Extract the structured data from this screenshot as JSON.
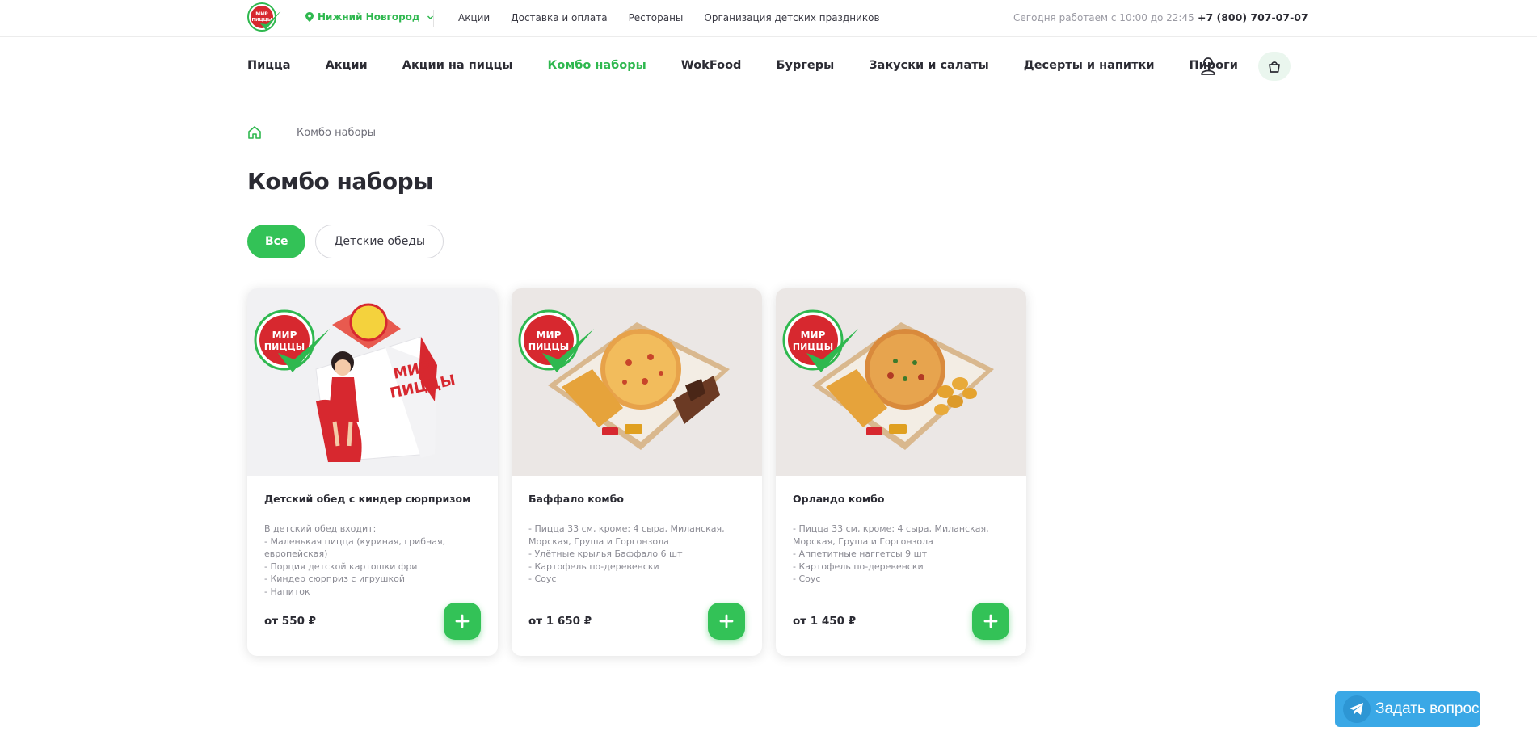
{
  "brand": {
    "logo_text": "МИР ПИЦЦЫ",
    "accent_color": "#33c257",
    "telegram_color": "#3aa8e6"
  },
  "topbar": {
    "city": "Нижний Новгород",
    "links": [
      "Акции",
      "Доставка и оплата",
      "Рестораны",
      "Организация детских праздников"
    ],
    "hours": "Сегодня работаем с 10:00 до 22:45",
    "phone": "+7 (800) 707-07-07"
  },
  "nav": {
    "items": [
      "Пицца",
      "Акции",
      "Акции на пиццы",
      "Комбо наборы",
      "WokFood",
      "Бургеры",
      "Закуски и салаты",
      "Десерты и напитки",
      "Пироги"
    ],
    "active_index": 3
  },
  "breadcrumb": {
    "current": "Комбо наборы"
  },
  "page": {
    "title": "Комбо наборы"
  },
  "filters": [
    {
      "label": "Все",
      "active": true
    },
    {
      "label": "Детские обеды",
      "active": false
    }
  ],
  "products": [
    {
      "name": "Детский обед с киндер сюрпризом",
      "description": "В детский обед входит:\n- Маленькая пицца (куриная, грибная, европейская)\n- Порция детской картошки фри\n- Киндер сюрприз с игрушкой\n- Напиток",
      "price": "от 550 ₽",
      "image": "kids-meal-box"
    },
    {
      "name": "Баффало комбо",
      "description": "- Пицца 33 см, кроме: 4 сыра, Миланская, Морская, Груша и Горгонзола\n- Улётные крылья Баффало 6 шт\n- Картофель по-деревенски\n- Соус",
      "price": "от 1 650 ₽",
      "image": "combo-box-wings"
    },
    {
      "name": "Орландо комбо",
      "description": "- Пицца 33 см, кроме: 4 сыра, Миланская, Морская, Груша и Горгонзола\n- Аппетитные наггетсы 9 шт\n- Картофель по-деревенски\n- Соус",
      "price": "от 1 450 ₽",
      "image": "combo-box-nuggets"
    }
  ],
  "ask_button": {
    "label": "Задать вопрос"
  }
}
